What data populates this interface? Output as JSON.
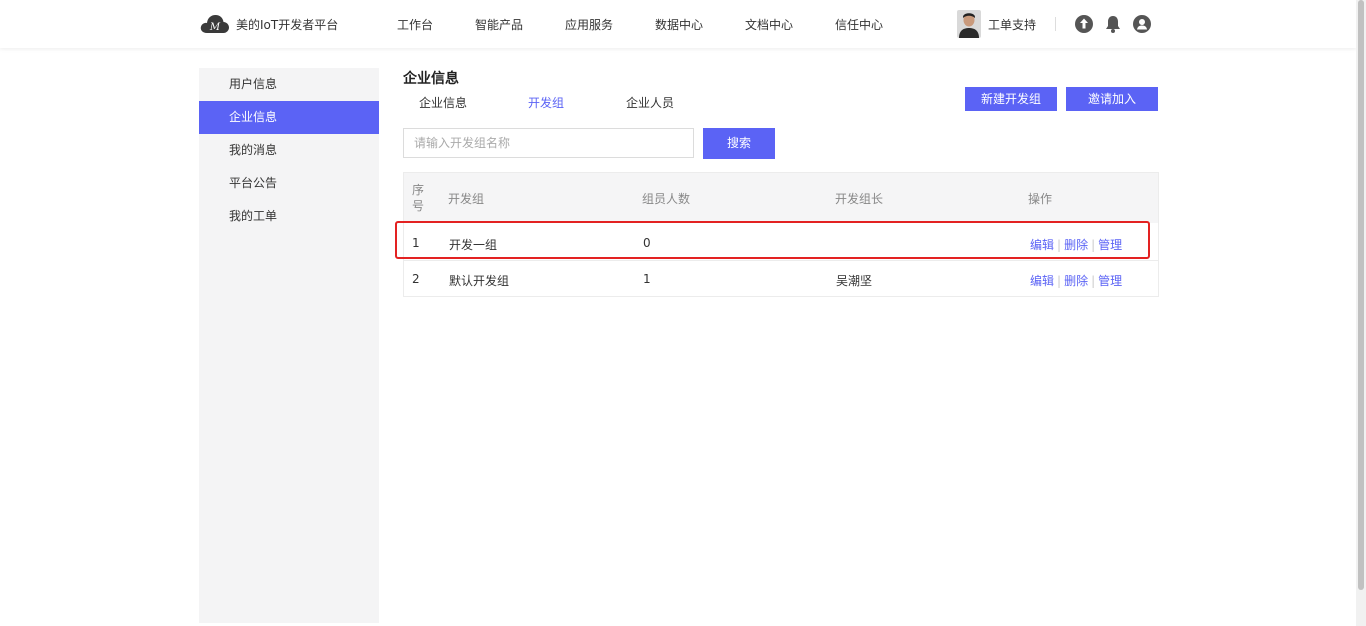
{
  "header": {
    "logo_text": "美的IoT开发者平台",
    "nav": [
      "工作台",
      "智能产品",
      "应用服务",
      "数据中心",
      "文档中心",
      "信任中心"
    ],
    "support_label": "工单支持",
    "icons": [
      "upload-icon",
      "bell-icon",
      "user-icon"
    ]
  },
  "sidebar": {
    "items": [
      "用户信息",
      "企业信息",
      "我的消息",
      "平台公告",
      "我的工单"
    ],
    "active_index": 1
  },
  "main": {
    "title": "企业信息",
    "tabs": [
      "企业信息",
      "开发组",
      "企业人员"
    ],
    "active_tab": 1,
    "new_group_button": "新建开发组",
    "invite_button": "邀请加入",
    "search_placeholder": "请输入开发组名称",
    "search_button": "搜索",
    "table": {
      "headers": [
        "序号",
        "开发组",
        "组员人数",
        "开发组长",
        "操作"
      ],
      "rows": [
        {
          "seq": "1",
          "name": "开发一组",
          "count": "0",
          "leader": ""
        },
        {
          "seq": "2",
          "name": "默认开发组",
          "count": "1",
          "leader": "吴潮坚"
        }
      ],
      "actions": [
        "编辑",
        "删除",
        "管理"
      ]
    }
  },
  "colors": {
    "accent": "#5b63f5",
    "highlight_border": "#e32222",
    "sidebar_bg": "#f4f4f5"
  }
}
